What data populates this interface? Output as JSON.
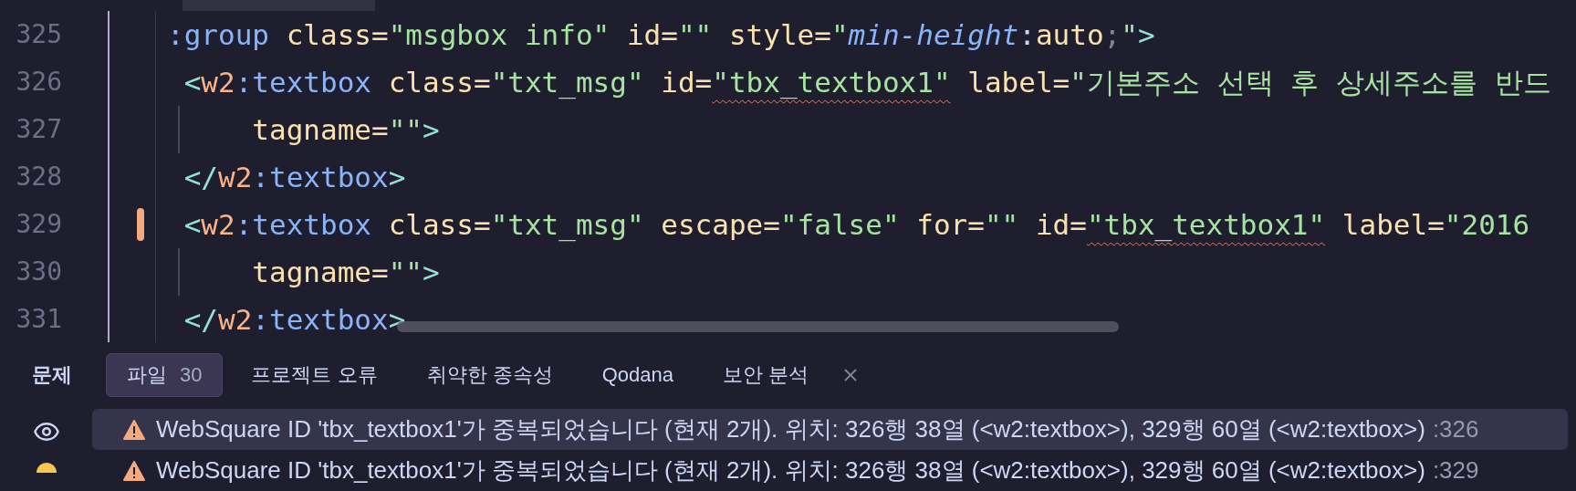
{
  "editor": {
    "lines": [
      {
        "number": "325",
        "changed": false,
        "guide": false,
        "tokens": [
          {
            "kind": "tag",
            "text": ":group"
          },
          {
            "kind": "attr",
            "text": " class="
          },
          {
            "kind": "str",
            "text": "\"msgbox info\""
          },
          {
            "kind": "attr",
            "text": " id="
          },
          {
            "kind": "str",
            "text": "\"\""
          },
          {
            "kind": "attr",
            "text": " style="
          },
          {
            "kind": "str",
            "text": "\""
          },
          {
            "kind": "prop",
            "text": "min-height"
          },
          {
            "kind": "plain",
            "text": ":"
          },
          {
            "kind": "value",
            "text": "auto"
          },
          {
            "kind": "semi",
            "text": ";"
          },
          {
            "kind": "str",
            "text": "\""
          },
          {
            "kind": "punct",
            "text": ">"
          }
        ]
      },
      {
        "number": "326",
        "changed": false,
        "guide": false,
        "tokens": [
          {
            "kind": "punct",
            "text": " <"
          },
          {
            "kind": "ns",
            "text": "w2"
          },
          {
            "kind": "tag",
            "text": ":textbox"
          },
          {
            "kind": "attr",
            "text": " class="
          },
          {
            "kind": "str",
            "text": "\"txt_msg\""
          },
          {
            "kind": "attr",
            "text": " id="
          },
          {
            "kind": "str",
            "text": "\"tbx_textbox1\"",
            "warn": true
          },
          {
            "kind": "attr",
            "text": " label="
          },
          {
            "kind": "str",
            "text": "\"기본주소 선택 후 상세주소를 반드"
          }
        ]
      },
      {
        "number": "327",
        "changed": false,
        "guide": true,
        "tokens": [
          {
            "kind": "attr",
            "text": "     tagname="
          },
          {
            "kind": "str",
            "text": "\"\""
          },
          {
            "kind": "punct",
            "text": ">"
          }
        ]
      },
      {
        "number": "328",
        "changed": false,
        "guide": false,
        "tokens": [
          {
            "kind": "punct",
            "text": " </"
          },
          {
            "kind": "ns",
            "text": "w2"
          },
          {
            "kind": "tag",
            "text": ":textbox"
          },
          {
            "kind": "punct",
            "text": ">"
          }
        ]
      },
      {
        "number": "329",
        "changed": true,
        "guide": false,
        "tokens": [
          {
            "kind": "punct",
            "text": " <"
          },
          {
            "kind": "ns",
            "text": "w2"
          },
          {
            "kind": "tag",
            "text": ":textbox"
          },
          {
            "kind": "attr",
            "text": " class="
          },
          {
            "kind": "str",
            "text": "\"txt_msg\""
          },
          {
            "kind": "attr",
            "text": " escape="
          },
          {
            "kind": "str",
            "text": "\"false\""
          },
          {
            "kind": "attr",
            "text": " for="
          },
          {
            "kind": "str",
            "text": "\"\""
          },
          {
            "kind": "attr",
            "text": " id="
          },
          {
            "kind": "str",
            "text": "\"tbx_textbox1\"",
            "warn": true
          },
          {
            "kind": "attr",
            "text": " label="
          },
          {
            "kind": "str",
            "text": "\"2016"
          }
        ]
      },
      {
        "number": "330",
        "changed": false,
        "guide": true,
        "tokens": [
          {
            "kind": "attr",
            "text": "     tagname="
          },
          {
            "kind": "str",
            "text": "\"\""
          },
          {
            "kind": "punct",
            "text": ">"
          }
        ]
      },
      {
        "number": "331",
        "changed": false,
        "guide": false,
        "tokens": [
          {
            "kind": "punct",
            "text": " </"
          },
          {
            "kind": "ns",
            "text": "w2"
          },
          {
            "kind": "tag",
            "text": ":textbox"
          },
          {
            "kind": "punct",
            "text": ">"
          }
        ]
      }
    ]
  },
  "problems_panel": {
    "title": "문제",
    "tabs": [
      {
        "label": "파일",
        "count": "30",
        "selected": true
      },
      {
        "label": "프로젝트 오류",
        "selected": false
      },
      {
        "label": "취약한 종속성",
        "selected": false
      },
      {
        "label": "Qodana",
        "selected": false
      },
      {
        "label": "보안 분석",
        "selected": false
      }
    ],
    "problems": [
      {
        "message": "WebSquare ID 'tbx_textbox1'가 중복되었습니다 (현재 2개). 위치: 326행 38열 (<w2:textbox>), 329행 60열 (<w2:textbox>)",
        "line": ":326",
        "selected": true
      },
      {
        "message": "WebSquare ID 'tbx_textbox1'가 중복되었습니다 (현재 2개). 위치: 326행 38열 (<w2:textbox>), 329행 60열 (<w2:textbox>)",
        "line": ":329",
        "selected": false
      }
    ]
  }
}
